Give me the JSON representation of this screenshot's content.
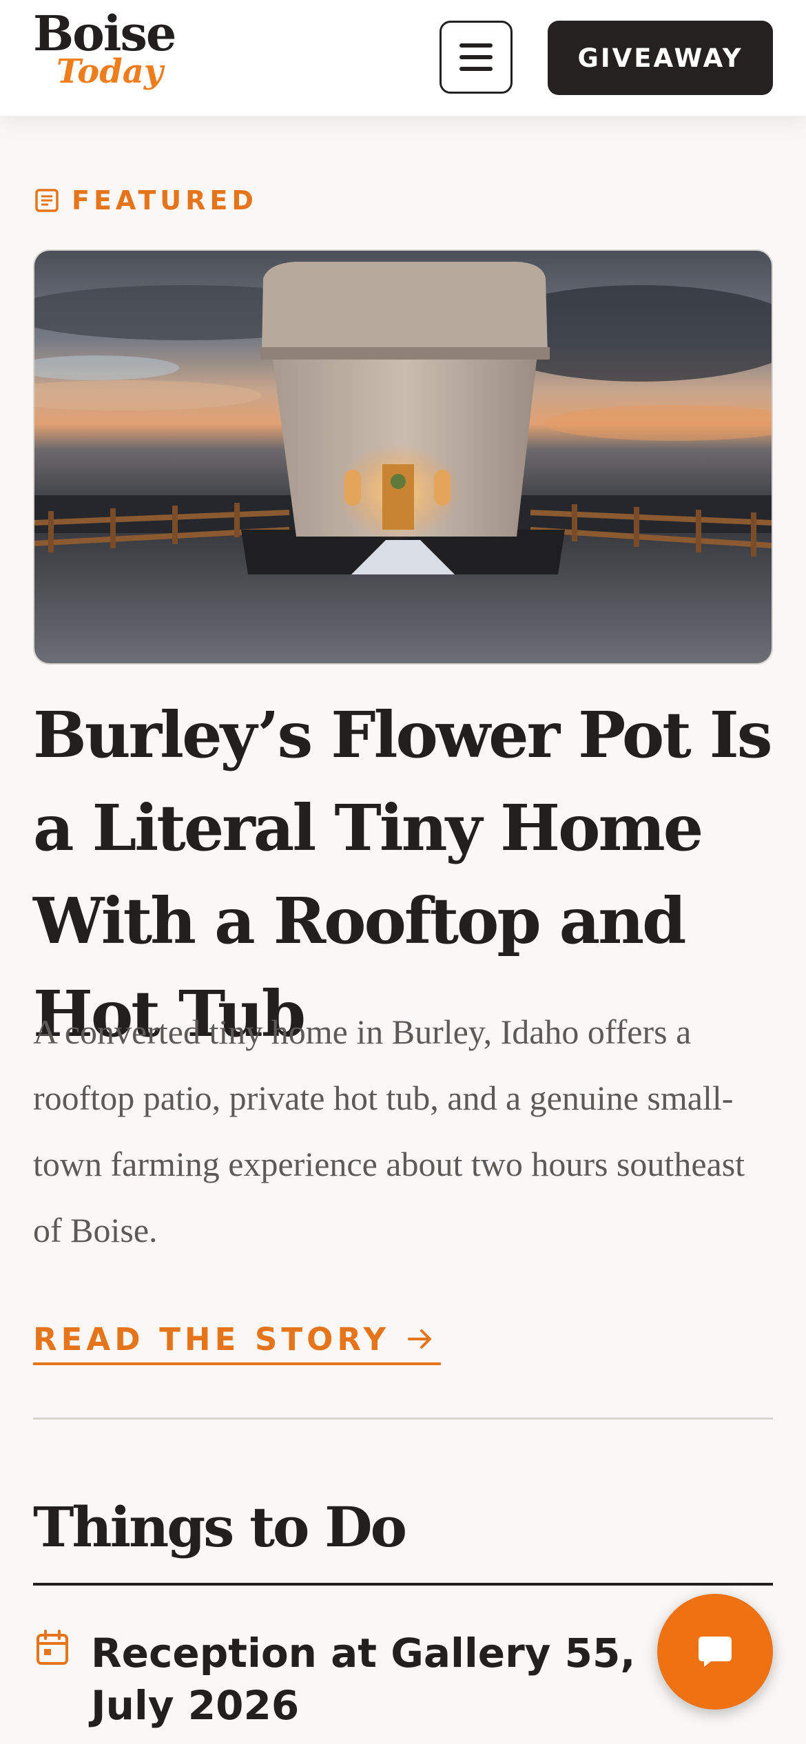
{
  "header": {
    "logo_line1": "Boise",
    "logo_line2": "Today",
    "giveaway_label": "GIVEAWAY"
  },
  "featured": {
    "label": "FEATURED",
    "headline": "Burley’s Flower Pot Is a Literal Tiny Home With a Rooftop and Hot Tub",
    "summary": "A converted tiny home in Burley, Idaho offers a rooftop patio, private hot tub, and a genuine small-town farming experience about two hours southeast of Boise.",
    "cta_label": "READ THE STORY"
  },
  "things_to_do": {
    "title": "Things to Do",
    "events": [
      {
        "title": "Reception at Gallery 55, July 2026"
      }
    ]
  },
  "colors": {
    "accent": "#e5741a",
    "dark": "#221f1f",
    "background": "#f9f8f7",
    "chat_button": "#ef7212"
  },
  "icons": {
    "menu": "hamburger-menu-icon",
    "featured": "article-icon",
    "cta": "arrow-right-icon",
    "event": "calendar-icon",
    "chat": "chat-bubble-icon"
  }
}
